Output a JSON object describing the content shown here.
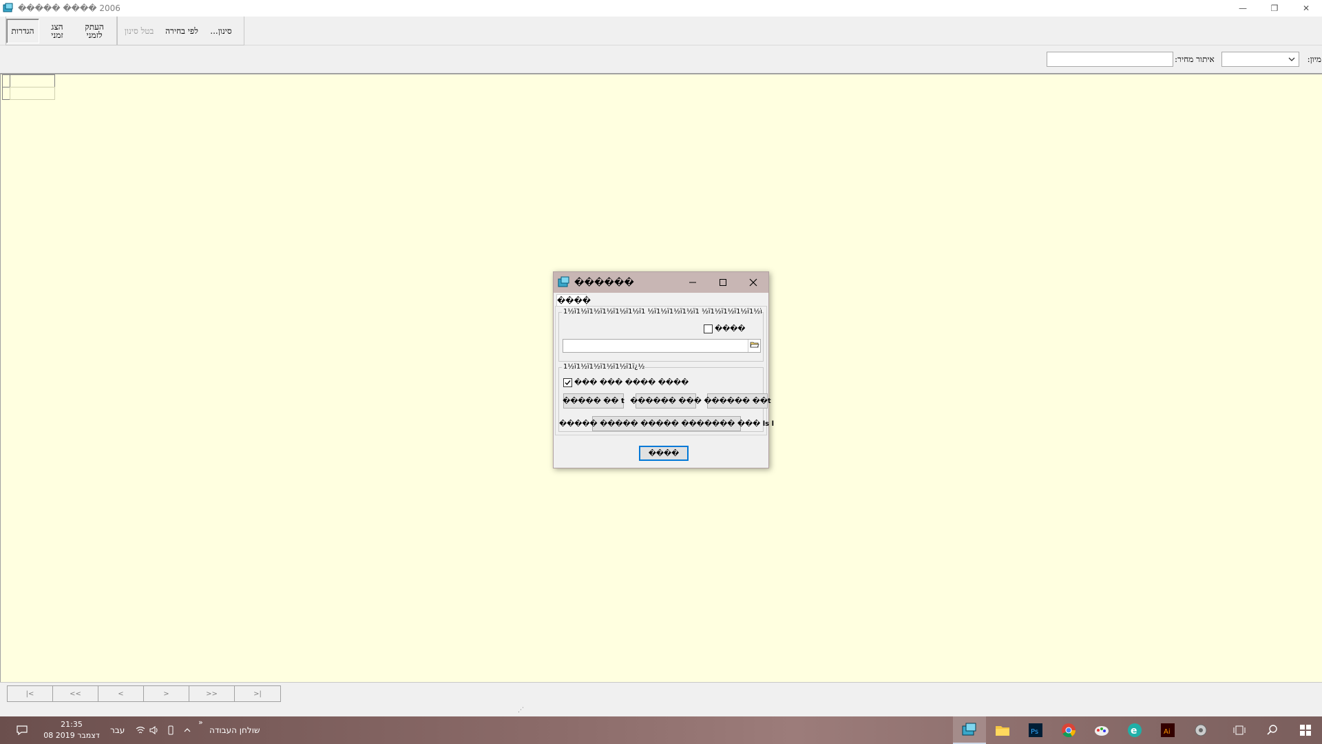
{
  "window": {
    "title": "����� ���� 2006",
    "minimize_glyph": "—",
    "restore_glyph": "❐",
    "close_glyph": "✕"
  },
  "toolbar": {
    "settings": "הגדרות",
    "show_temp_line1": "הצג",
    "show_temp_line2": "זמני",
    "copy_temp_line1": "העתק",
    "copy_temp_line2": "לזמני",
    "cancel_filter": "בטל סינון",
    "by_selection": "לפי בחירה",
    "filter": "סינון..."
  },
  "filter_row": {
    "sort_label": "מיון:",
    "price_search_label": "איתור מחיר:",
    "sort_value": "",
    "price_search_value": ""
  },
  "bottom_nav": {
    "buttons": [
      "|<",
      "<<",
      "<",
      ">",
      ">>",
      ">|"
    ]
  },
  "taskbar": {
    "time": "21:35",
    "date": "08 דצמבר 2019",
    "lang": "עבר",
    "desktop": "שולחן העבודה",
    "chevron": "«",
    "apps": [
      "app-icon",
      "file-explorer-icon",
      "photoshop-icon",
      "chrome-icon",
      "paint-icon",
      "edge-icon",
      "illustrator-icon",
      "settings-app-icon"
    ]
  },
  "dialog": {
    "title": "������",
    "tab_label": "����",
    "group1_legend": "1½ï1½ï1½ï1½ï1½ï1½ï1 ½ï1½ï1½ï1½ï1 ½ï1½ï1½ï1½ï1½ï1",
    "checkbox1_label": "����",
    "checkbox1_checked": false,
    "path_value": "",
    "group2_legend": "1½ï1½ï1½ï1½ï1½ï1ï¿½",
    "checkbox2_label": "��� ��� ���� ����",
    "checkbox2_checked": true,
    "btn1": "����� �� t",
    "btn2": "������ ���",
    "btn3": "������ ��t",
    "btn4": "����� ����� ����� ������� ��� ls l",
    "ok": "����"
  }
}
